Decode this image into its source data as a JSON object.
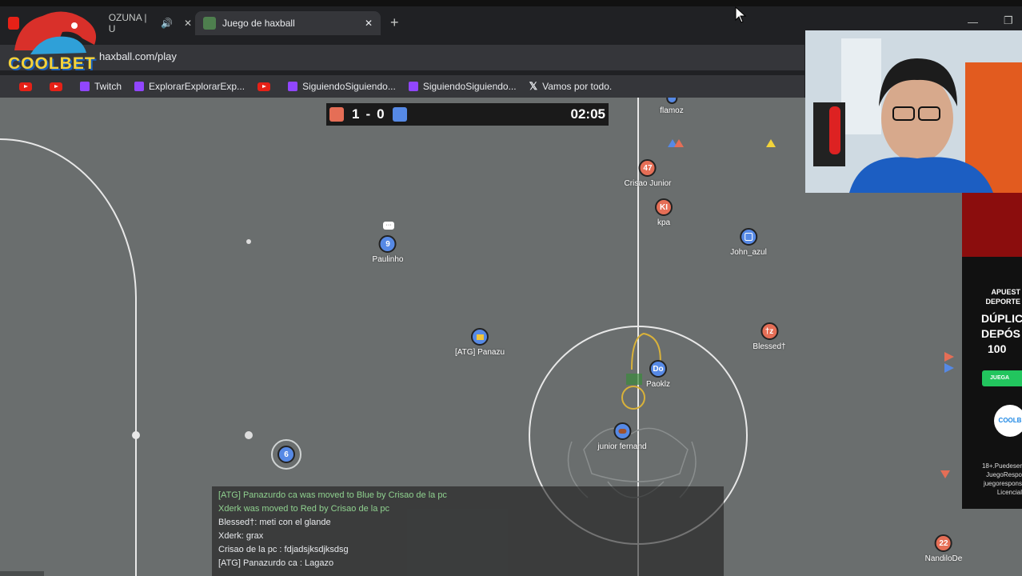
{
  "browser": {
    "tabs": [
      {
        "label": "OZUNA | U",
        "active": false
      },
      {
        "label": "Juego de haxball",
        "active": true
      }
    ],
    "new_tab": "+",
    "url": "haxball.com/play",
    "bookmarks": [
      {
        "label": "",
        "icon": "youtube-icon"
      },
      {
        "label": "",
        "icon": "youtube-icon"
      },
      {
        "label": "Twitch",
        "icon": "twitch-icon"
      },
      {
        "label": "ExplorarExplorarExp...",
        "icon": "twitch-icon"
      },
      {
        "label": "",
        "icon": "youtube-icon"
      },
      {
        "label": "SiguiendoSiguiendo...",
        "icon": "twitch-icon"
      },
      {
        "label": "SiguiendoSiguiendo...",
        "icon": "twitch-icon"
      },
      {
        "label": "Vamos por todo.",
        "icon": "x-icon"
      }
    ]
  },
  "overlay": {
    "logo_text": "COOLBET"
  },
  "score": {
    "red": "1",
    "sep": "-",
    "blue": "0",
    "time": "02:05",
    "red_color": "#e56e56",
    "blue_color": "#5689e5"
  },
  "players": [
    {
      "name": "flamoz",
      "avatar": "",
      "team": "blue"
    },
    {
      "name": "Crisao Junior",
      "avatar": "47",
      "team": "red"
    },
    {
      "name": "kpa",
      "avatar": "KI",
      "team": "red"
    },
    {
      "name": "John_azul",
      "avatar": "",
      "team": "blue"
    },
    {
      "name": "Paulinho",
      "avatar": "9",
      "team": "blue"
    },
    {
      "name": "[ATG] Panazu",
      "avatar": "",
      "team": "blue"
    },
    {
      "name": "Blessed†",
      "avatar": "†z",
      "team": "red"
    },
    {
      "name": "Paoklz",
      "avatar": "Do",
      "team": "blue"
    },
    {
      "name": "junior fernand",
      "avatar": "",
      "team": "blue"
    },
    {
      "name": "",
      "avatar": "6",
      "team": "blue"
    },
    {
      "name": "NandiloDe",
      "avatar": "22",
      "team": "red"
    }
  ],
  "chat": [
    {
      "text": "[ATG] Panazurdo ca      was moved to Blue by Crisao de la pc",
      "style": "system"
    },
    {
      "text": "Xderk was moved to Red by Crisao de la pc",
      "style": "system"
    },
    {
      "text": "Blessed†: meti con el glande",
      "style": "normal"
    },
    {
      "text": "Xderk: grax",
      "style": "normal"
    },
    {
      "text": "Crisao de la pc : fdjadsjksdjksdsg",
      "style": "normal"
    },
    {
      "text": "[ATG] Panazurdo ca      : Lagazo",
      "style": "normal"
    }
  ],
  "ad": {
    "line1": "APUEST",
    "line2": "DEPORTE",
    "line3": "DÚPLIC",
    "line4": "DEPÓS",
    "line5": "100",
    "button": "JUEGA",
    "brand": "COOLB",
    "footer1": "18+.Puedeser",
    "footer2": "JuegoRespo",
    "footer3": "juegorespons",
    "footer4": "Licencial"
  }
}
